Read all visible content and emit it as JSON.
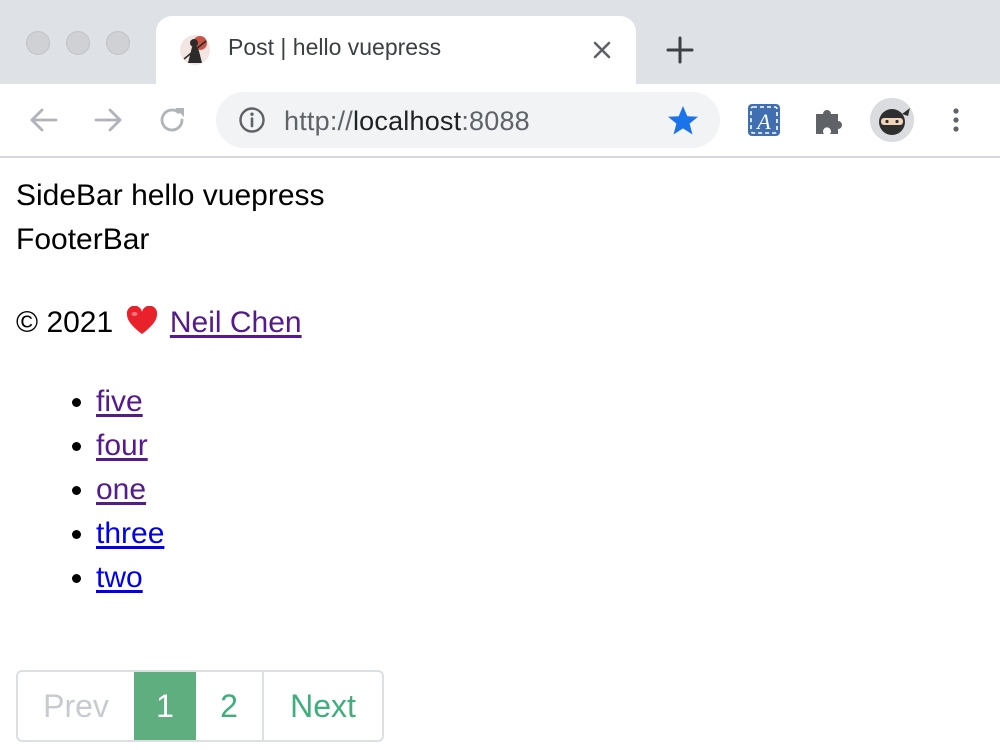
{
  "browser": {
    "tab_title": "Post | hello vuepress",
    "url_scheme": "http://",
    "url_host": "localhost",
    "url_port": ":8088",
    "accent_star_color": "#1a73e8"
  },
  "page": {
    "line1": "SideBar hello vuepress",
    "line2": "FooterBar",
    "copyright_prefix": "© 2021",
    "author_link": "Neil Chen",
    "tags": [
      {
        "label": "five",
        "visited": true
      },
      {
        "label": "four",
        "visited": true
      },
      {
        "label": "one",
        "visited": true
      },
      {
        "label": "three",
        "visited": false
      },
      {
        "label": "two",
        "visited": false
      }
    ]
  },
  "pagination": {
    "prev_label": "Prev",
    "pages": [
      "1",
      "2"
    ],
    "current_page": "1",
    "next_label": "Next",
    "active_color": "#5fae7f",
    "link_color": "#3eaf7c"
  }
}
